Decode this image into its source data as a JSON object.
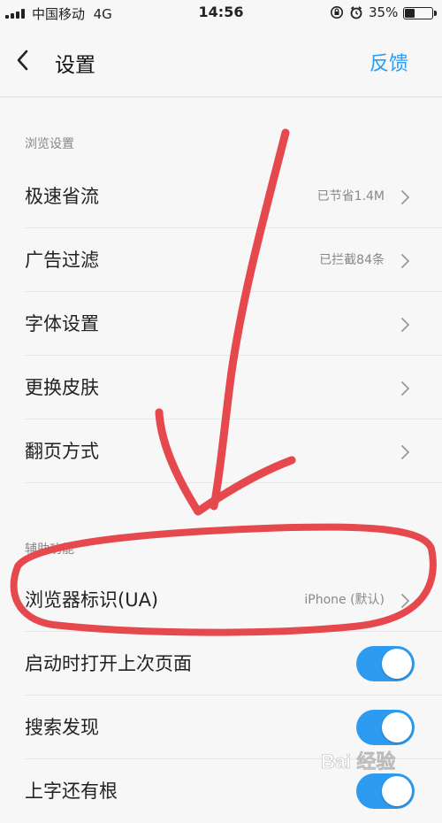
{
  "status_bar": {
    "carrier": "中国移动",
    "network": "4G",
    "time": "14:56",
    "battery_percent": "35%",
    "icons": [
      "signal-icon",
      "rotation-lock-icon",
      "alarm-icon",
      "battery-icon"
    ]
  },
  "nav": {
    "back_icon": "chevron-left-icon",
    "title": "设置",
    "action_label": "反馈",
    "accent_color": "#2d9cf0"
  },
  "sections": [
    {
      "header": "浏览设置",
      "rows": [
        {
          "label": "极速省流",
          "value": "已节省1.4M"
        },
        {
          "label": "广告过滤",
          "value": "已拦截84条"
        },
        {
          "label": "字体设置",
          "value": ""
        },
        {
          "label": "更换皮肤",
          "value": ""
        },
        {
          "label": "翻页方式",
          "value": ""
        }
      ]
    },
    {
      "header": "辅助功能",
      "rows": [
        {
          "label": "浏览器标识(UA)",
          "value": "iPhone (默认)"
        },
        {
          "label": "启动时打开上次页面",
          "toggle": true
        },
        {
          "label": "搜索发现",
          "toggle": true
        },
        {
          "label": "上字还有根",
          "toggle": true
        }
      ]
    }
  ],
  "annotation": {
    "color": "#e5484d",
    "shapes": [
      "arrow",
      "ellipse"
    ]
  },
  "watermark": {
    "text": "Bai 经验",
    "icon": "baidu-paw-icon"
  }
}
